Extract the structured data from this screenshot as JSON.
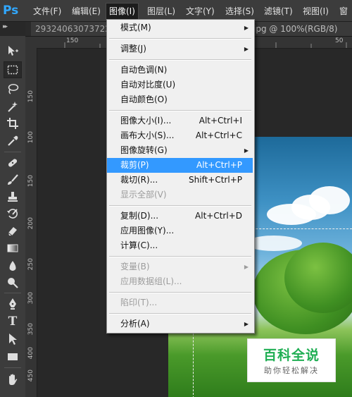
{
  "app": {
    "logo": "Ps"
  },
  "menubar": {
    "items": [
      {
        "label": "文件(F)"
      },
      {
        "label": "编辑(E)"
      },
      {
        "label": "图像(I)"
      },
      {
        "label": "图层(L)"
      },
      {
        "label": "文字(Y)"
      },
      {
        "label": "选择(S)"
      },
      {
        "label": "滤镜(T)"
      },
      {
        "label": "视图(I)"
      },
      {
        "label": "窗"
      }
    ],
    "active_index": 2
  },
  "tabs": {
    "left_label": "29324063073722",
    "close_glyph": "×",
    "right_label": "jpg @ 100%(RGB/8)",
    "collapse_glyph": "▸▸"
  },
  "ruler": {
    "top_labels": [
      "150",
      "100",
      "50"
    ],
    "left_labels": [
      "1",
      "5",
      "0",
      "1",
      "0",
      "0",
      "1",
      "5",
      "0",
      "2",
      "0",
      "0",
      "2",
      "5",
      "0",
      "3",
      "0",
      "0",
      "3",
      "5",
      "0",
      "4",
      "0",
      "0",
      "4",
      "5",
      "0",
      "5",
      "0",
      "0"
    ]
  },
  "image_menu": {
    "items": [
      {
        "label": "模式(M)",
        "shortcut": "",
        "submenu": true,
        "state": "normal"
      },
      {
        "label": "调整(J)",
        "shortcut": "",
        "submenu": true,
        "state": "normal"
      },
      {
        "label": "自动色调(N)",
        "shortcut": "",
        "submenu": false,
        "state": "normal"
      },
      {
        "label": "自动对比度(U)",
        "shortcut": "",
        "submenu": false,
        "state": "normal"
      },
      {
        "label": "自动颜色(O)",
        "shortcut": "",
        "submenu": false,
        "state": "normal"
      },
      {
        "label": "图像大小(I)...",
        "shortcut": "Alt+Ctrl+I",
        "submenu": false,
        "state": "normal"
      },
      {
        "label": "画布大小(S)...",
        "shortcut": "Alt+Ctrl+C",
        "submenu": false,
        "state": "normal"
      },
      {
        "label": "图像旋转(G)",
        "shortcut": "",
        "submenu": true,
        "state": "normal"
      },
      {
        "label": "裁剪(P)",
        "shortcut": "Alt+Ctrl+P",
        "submenu": false,
        "state": "highlighted"
      },
      {
        "label": "裁切(R)...",
        "shortcut": "Shift+Ctrl+P",
        "submenu": false,
        "state": "normal"
      },
      {
        "label": "显示全部(V)",
        "shortcut": "",
        "submenu": false,
        "state": "disabled"
      },
      {
        "label": "复制(D)...",
        "shortcut": "Alt+Ctrl+D",
        "submenu": false,
        "state": "normal"
      },
      {
        "label": "应用图像(Y)...",
        "shortcut": "",
        "submenu": false,
        "state": "normal"
      },
      {
        "label": "计算(C)...",
        "shortcut": "",
        "submenu": false,
        "state": "normal"
      },
      {
        "label": "变量(B)",
        "shortcut": "",
        "submenu": true,
        "state": "disabled"
      },
      {
        "label": "应用数据组(L)...",
        "shortcut": "",
        "submenu": false,
        "state": "disabled"
      },
      {
        "label": "陷印(T)...",
        "shortcut": "",
        "submenu": false,
        "state": "disabled"
      },
      {
        "label": "分析(A)",
        "shortcut": "",
        "submenu": true,
        "state": "normal"
      }
    ],
    "submenu_arrow": "▶"
  },
  "toolbox": {
    "tools": [
      {
        "name": "move-tool-icon"
      },
      {
        "name": "rectangular-marquee-icon"
      },
      {
        "name": "lasso-icon"
      },
      {
        "name": "magic-wand-icon"
      },
      {
        "name": "crop-icon"
      },
      {
        "name": "eyedropper-icon"
      },
      {
        "name": "healing-brush-icon"
      },
      {
        "name": "brush-icon"
      },
      {
        "name": "clone-stamp-icon"
      },
      {
        "name": "history-brush-icon"
      },
      {
        "name": "eraser-icon"
      },
      {
        "name": "gradient-icon"
      },
      {
        "name": "blur-icon"
      },
      {
        "name": "dodge-icon"
      },
      {
        "name": "pen-icon"
      },
      {
        "name": "type-icon"
      },
      {
        "name": "path-selection-icon"
      },
      {
        "name": "rectangle-shape-icon"
      },
      {
        "name": "hand-icon"
      }
    ],
    "selected_index": 1,
    "type_glyph": "T"
  },
  "watermark": {
    "title": "百科全说",
    "subtitle": "助你轻松解决"
  },
  "colors": {
    "menu_highlight": "#3399ff",
    "ps_blue": "#31a8ff",
    "badge_green": "#1fae53"
  }
}
